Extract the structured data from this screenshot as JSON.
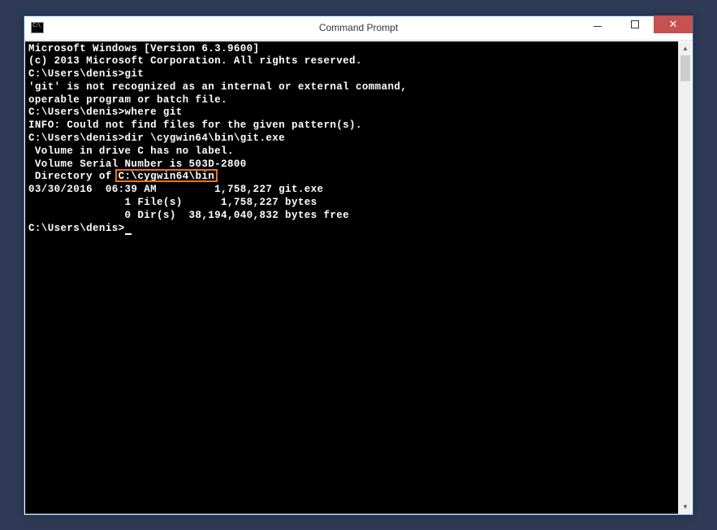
{
  "window": {
    "title": "Command Prompt",
    "icon_label": "cmd-icon"
  },
  "lines": {
    "l0": "Microsoft Windows [Version 6.3.9600]",
    "l1": "(c) 2013 Microsoft Corporation. All rights reserved.",
    "l2": "",
    "l3": "C:\\Users\\denis>git",
    "l4": "'git' is not recognized as an internal or external command,",
    "l5": "operable program or batch file.",
    "l6": "",
    "l7": "C:\\Users\\denis>where git",
    "l8": "INFO: Could not find files for the given pattern(s).",
    "l9": "",
    "l10": "C:\\Users\\denis>dir \\cygwin64\\bin\\git.exe",
    "l11": " Volume in drive C has no label.",
    "l12": " Volume Serial Number is 503D-2800",
    "l13": "",
    "l14_pre": " Directory of ",
    "l14_hl": "C:\\cygwin64\\bin",
    "l15": "",
    "l16": "03/30/2016  06:39 AM         1,758,227 git.exe",
    "l17": "               1 File(s)      1,758,227 bytes",
    "l18": "               0 Dir(s)  38,194,040,832 bytes free",
    "l19": "",
    "l20": "C:\\Users\\denis>"
  },
  "highlight": {
    "path": "C:\\cygwin64\\bin"
  }
}
